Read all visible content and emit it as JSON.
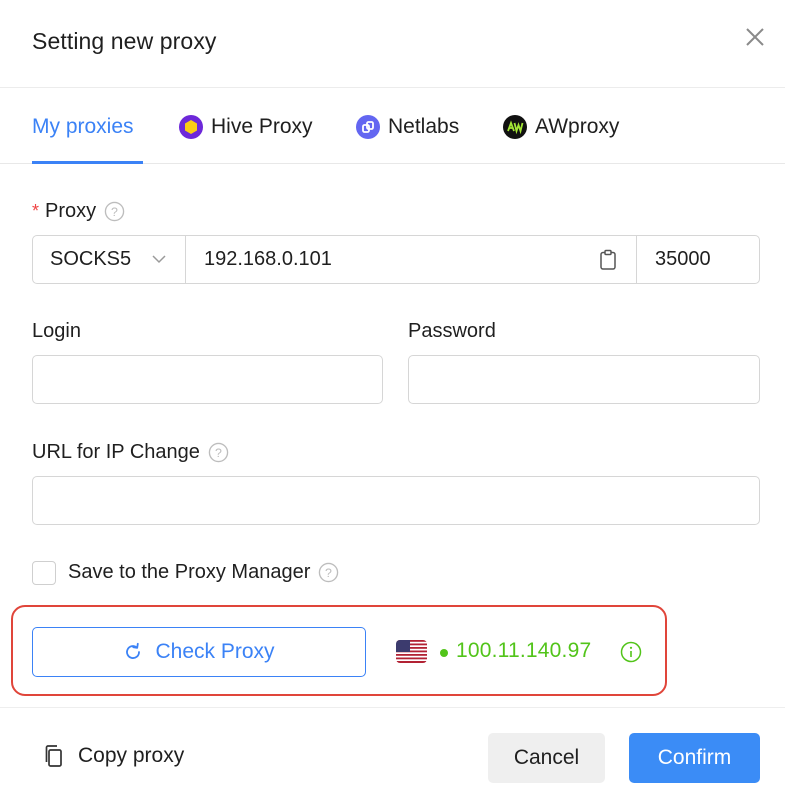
{
  "dialog": {
    "title": "Setting new proxy",
    "close_icon": "close-icon"
  },
  "tabs": [
    {
      "label": "My proxies",
      "icon": null,
      "active": true
    },
    {
      "label": "Hive Proxy",
      "icon": "hive-proxy-logo-icon",
      "active": false
    },
    {
      "label": "Netlabs",
      "icon": "netlabs-logo-icon",
      "active": false
    },
    {
      "label": "AWproxy",
      "icon": "awproxy-logo-icon",
      "active": false
    }
  ],
  "proxy": {
    "label": "Proxy",
    "required_mark": "*",
    "type": "SOCKS5",
    "host": "192.168.0.101",
    "port": "35000"
  },
  "login": {
    "label": "Login",
    "value": ""
  },
  "password": {
    "label": "Password",
    "value": ""
  },
  "ip_change_url": {
    "label": "URL for IP Change",
    "value": ""
  },
  "save_to_manager": {
    "label": "Save to the Proxy Manager",
    "checked": false
  },
  "check": {
    "button_label": "Check Proxy",
    "result_country": "US",
    "result_ip": "100.11.140.97",
    "result_status": "ok"
  },
  "footer": {
    "copy_label": "Copy proxy",
    "cancel_label": "Cancel",
    "confirm_label": "Confirm"
  },
  "colors": {
    "accent": "#3b82f6",
    "success": "#52c41a",
    "required": "#ef4444",
    "highlight": "#e0453a"
  }
}
